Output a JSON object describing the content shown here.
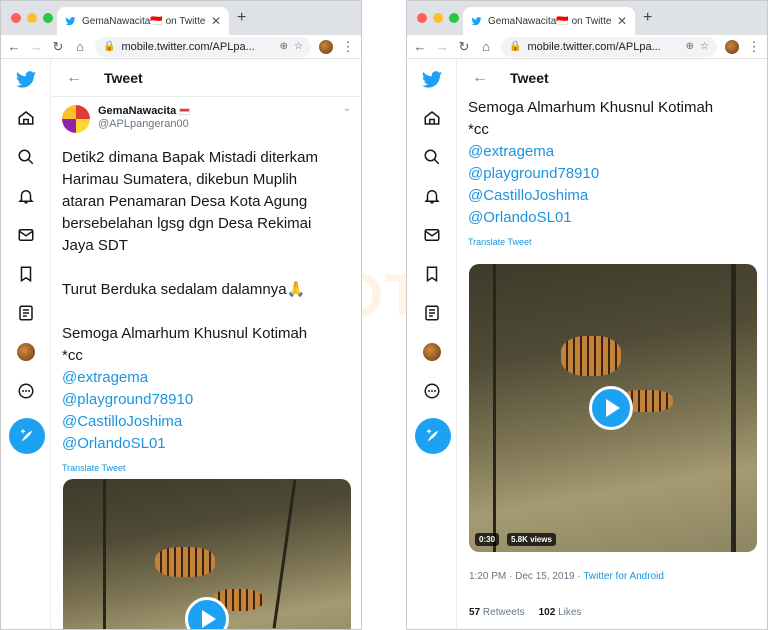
{
  "browser": {
    "tab_title": "GemaNawacita🇮🇩 on Twitter: \"D",
    "url": "mobile.twitter.com/APLpa..."
  },
  "header": {
    "title": "Tweet"
  },
  "tweet": {
    "author_name": "GemaNawacita",
    "author_handle": "@APLpangeran00",
    "text_lines": [
      "Detik2 dimana Bapak Mistadi diterkam",
      "Harimau Sumatera, dikebun Muplih",
      "ataran Penamaran Desa Kota Agung",
      "bersebelahan lgsg dgn Desa Rekimai",
      "Jaya SDT"
    ],
    "condolence": "Turut Berduka sedalam dalamnya🙏",
    "prayer": "Semoga Almarhum Khusnul Kotimah",
    "cc": "*cc",
    "mentions": [
      "@extragema",
      "@playground78910",
      "@CastilloJoshima",
      "@OrlandoSL01"
    ],
    "translate": "Translate Tweet",
    "video_duration": "0:30",
    "video_views": "5.8K views",
    "time": "1:20 PM · Dec 15, 2019 · ",
    "source": "Twitter for Android",
    "retweets": "57",
    "retweets_label": "Retweets",
    "likes": "102",
    "likes_label": "Likes"
  },
  "watermark": "SCREENSHOT BY",
  "colors": {
    "twitter_blue": "#1da1f2",
    "link": "#1b95e0",
    "titlebar": "#dee1e6"
  },
  "icons": {
    "sidebar": [
      "twitter-logo-icon",
      "home-icon",
      "search-icon",
      "bell-icon",
      "mail-icon",
      "bookmark-icon",
      "list-icon",
      "profile-avatar",
      "more-icon",
      "compose-icon"
    ]
  }
}
